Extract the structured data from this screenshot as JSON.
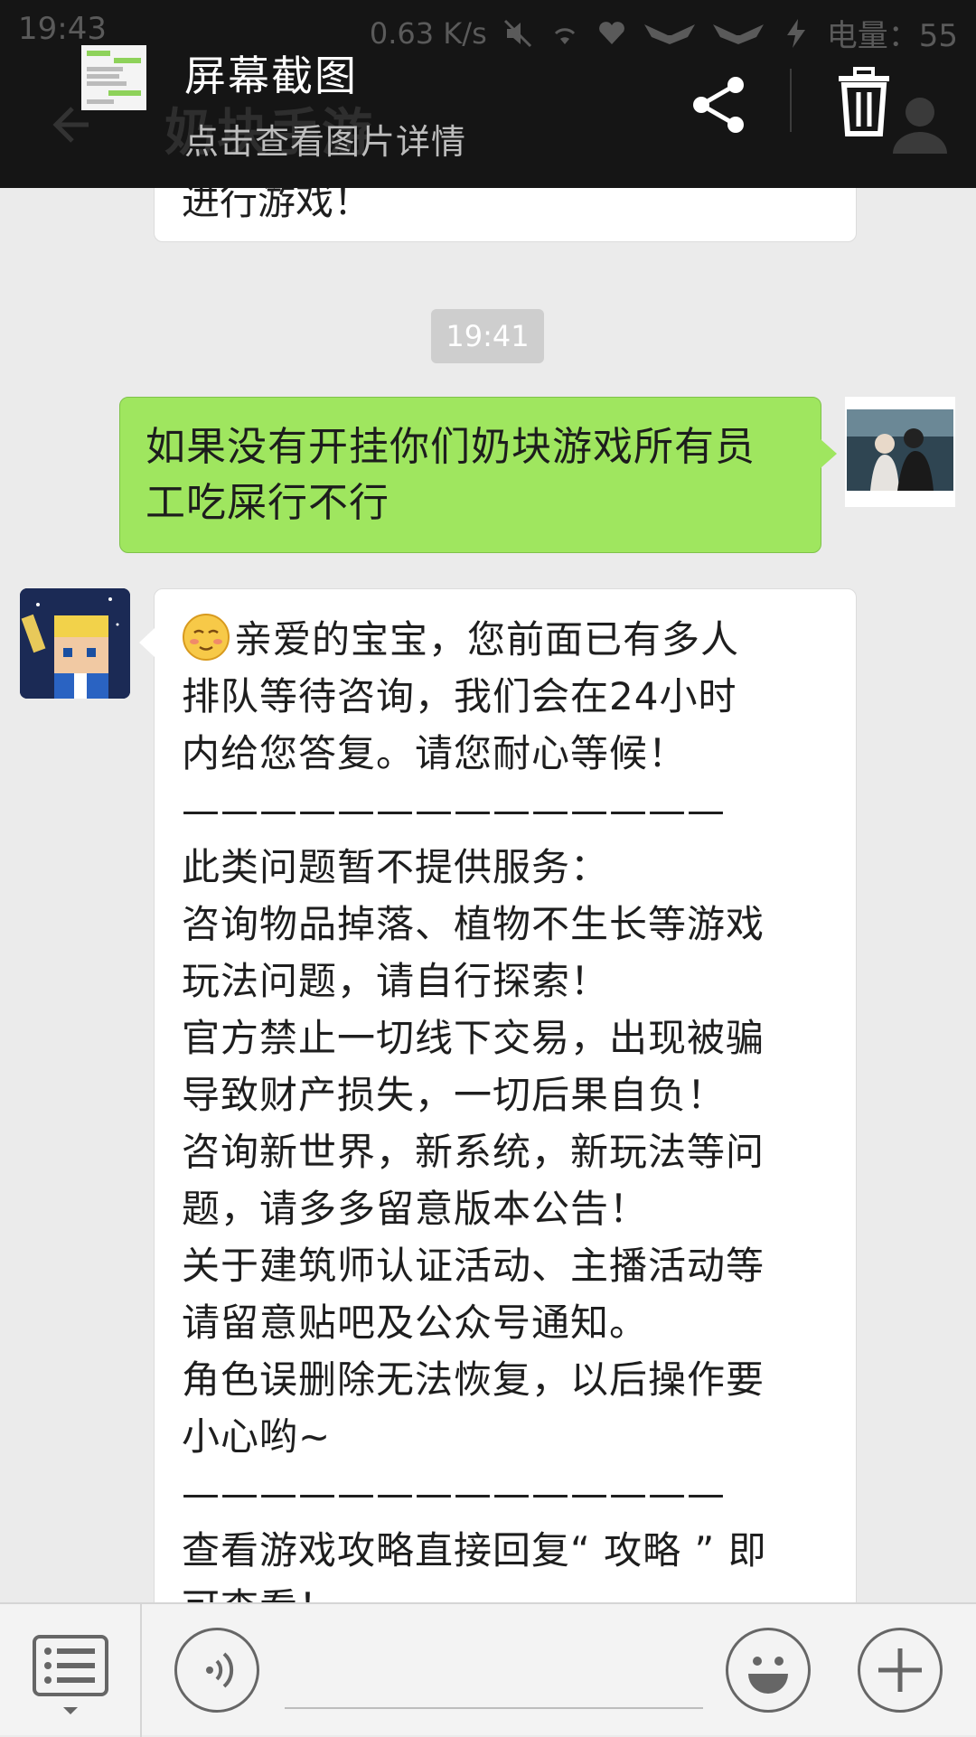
{
  "status_bar": {
    "time": "19:43",
    "network_speed": "0.63 K/s",
    "battery_label": "电量：55",
    "icons": [
      "mute-icon",
      "wifi-icon",
      "heart-rate-icon",
      "wings-icon",
      "wings-icon",
      "charging-icon"
    ]
  },
  "app_bar": {
    "title": "奶块手游",
    "back_icon": "back-arrow-icon",
    "profile_icon": "profile-icon"
  },
  "notification": {
    "title": "屏幕截图",
    "subtitle": "点击查看图片详情",
    "share_icon": "share-icon",
    "delete_icon": "trash-icon"
  },
  "chat": {
    "previous_message_tail": "进行游戏！",
    "timestamp": "19:41",
    "sent_message": {
      "lines": [
        "如果没有开挂你们奶块游戏所有员",
        "工吃屎行不行"
      ]
    },
    "received_message": {
      "lines": [
        "亲爱的宝宝，您前面已有多人",
        "排队等待咨询，我们会在24小时",
        "内给您答复。请您耐心等候！",
        "——————————————",
        "此类问题暂不提供服务：",
        "咨询物品掉落、植物不生长等游戏",
        "玩法问题，请自行探索！",
        "官方禁止一切线下交易，出现被骗",
        "导致财产损失，一切后果自负！",
        "咨询新世界，新系统，新玩法等问",
        "题，请多多留意版本公告！",
        "关于建筑师认证活动、主播活动等",
        "请留意贴吧及公众号通知。",
        "角色误删除无法恢复，以后操作要",
        "小心哟~",
        "——————————————",
        "查看游戏攻略直接回复“ 攻略 ” 即",
        "可查看！"
      ]
    }
  },
  "input_bar": {
    "menu_icon": "list-menu-icon",
    "voice_icon": "voice-icon",
    "emoji_icon": "emoji-icon",
    "plus_icon": "plus-icon",
    "placeholder": ""
  },
  "colors": {
    "sent_bubble": "#9fe65f",
    "overlay": "#151515",
    "chat_background": "#ebebeb",
    "timestamp_bg": "#cecece"
  }
}
